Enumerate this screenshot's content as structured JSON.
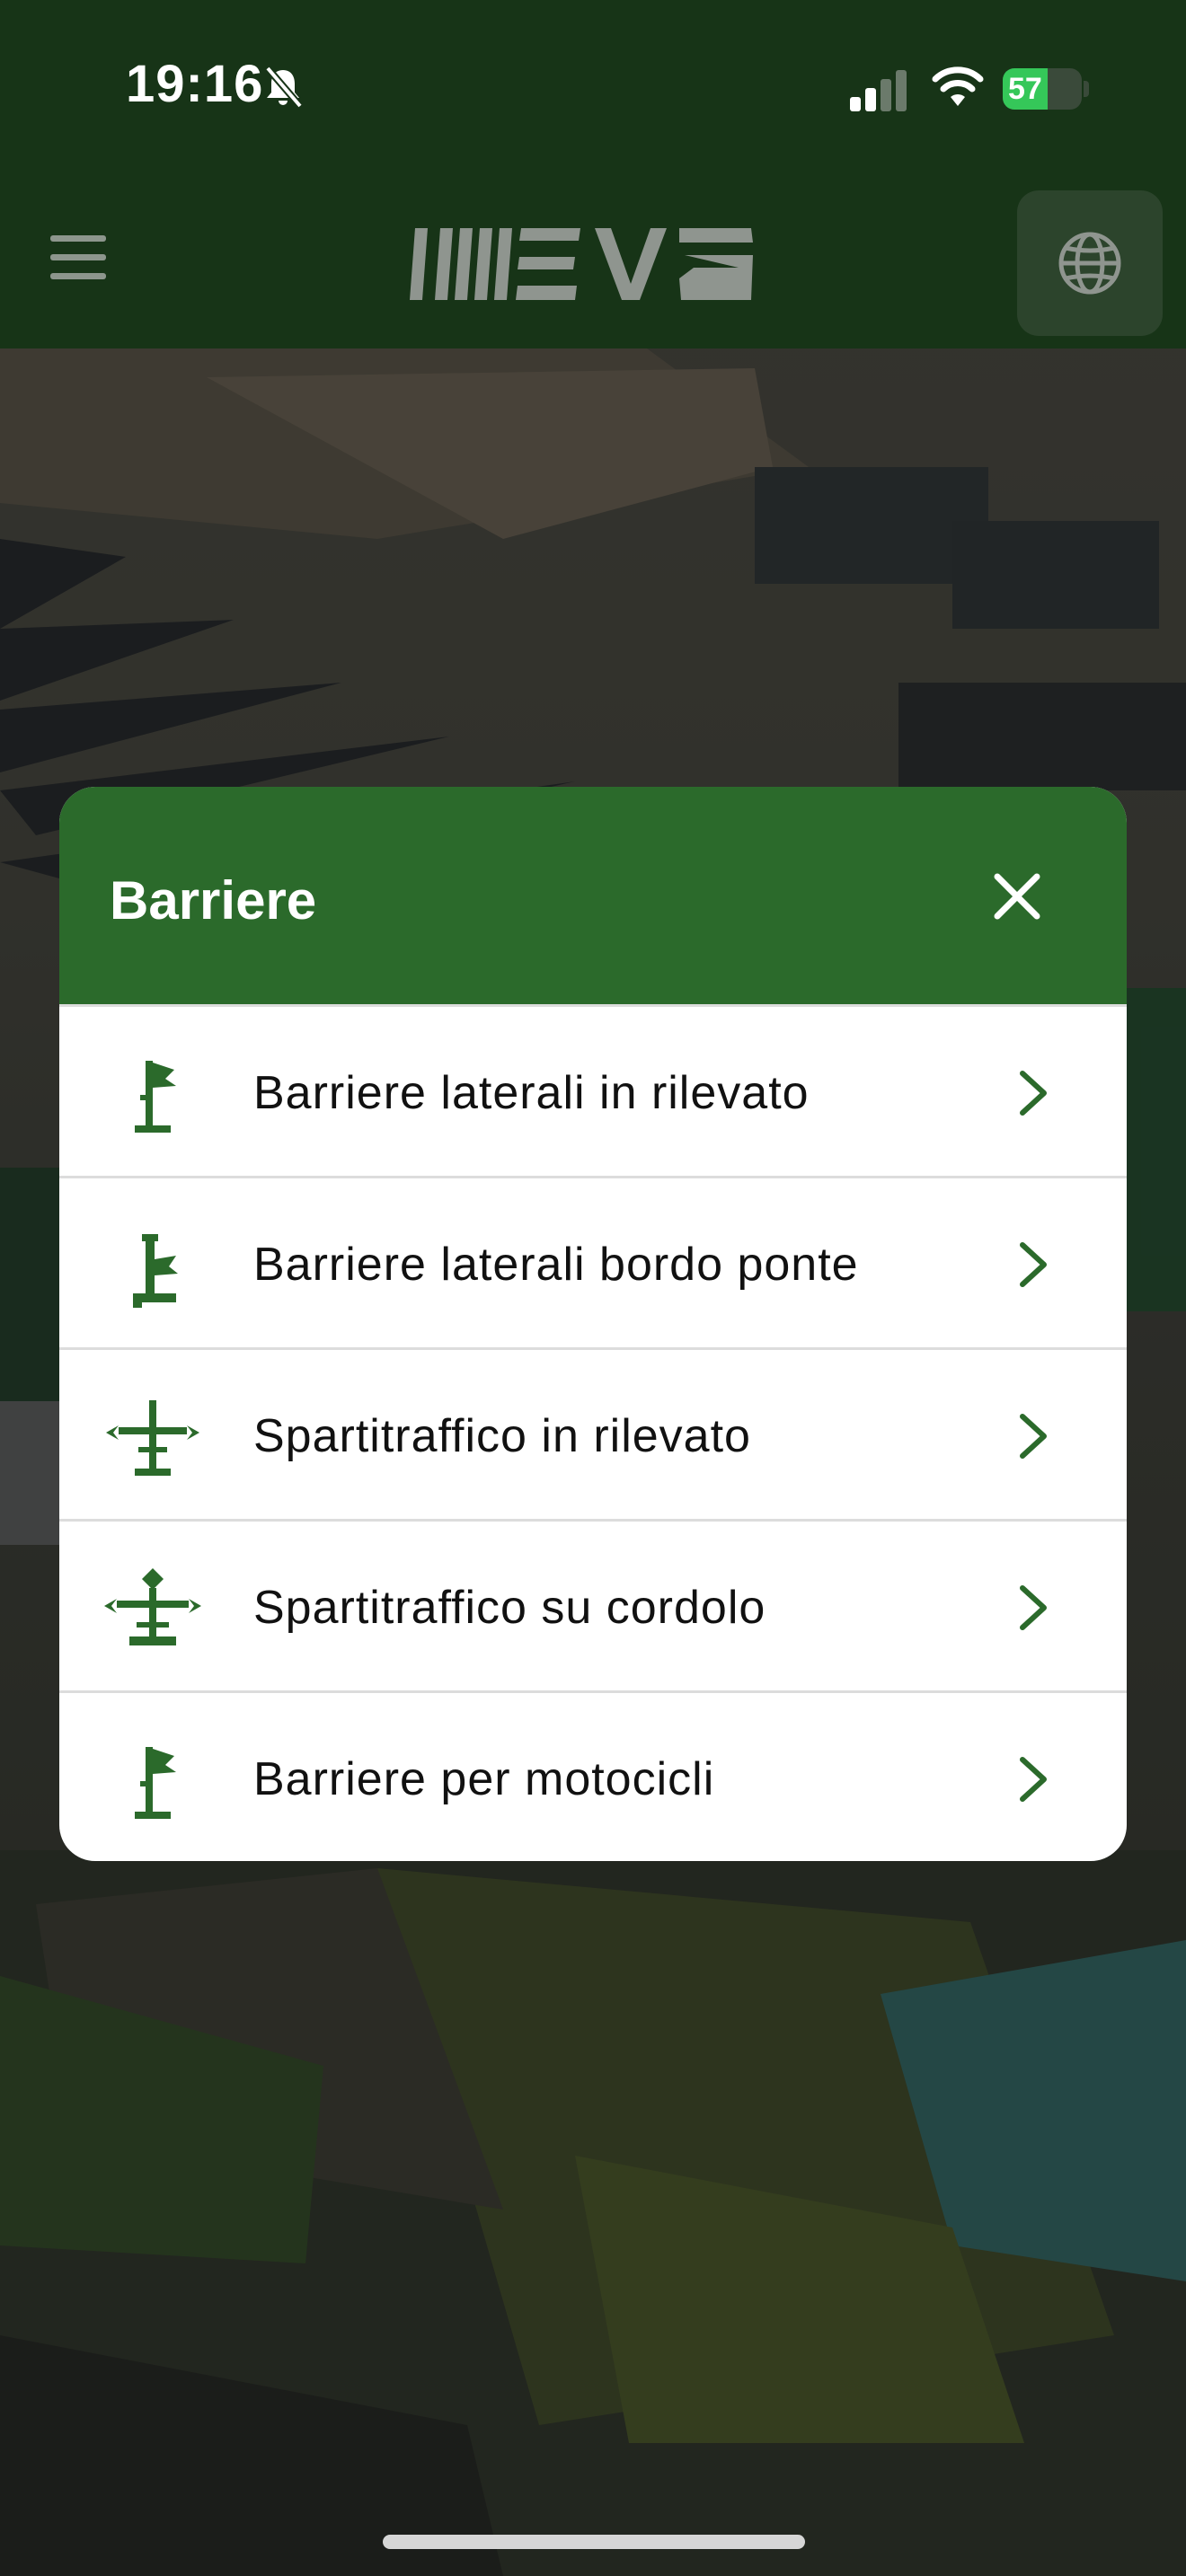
{
  "status_bar": {
    "time": "19:16",
    "battery": "57",
    "battery_level": 0.57
  },
  "header": {
    "menu_icon": "hamburger-icon",
    "logo": "IMEVA",
    "language_icon": "globe-icon"
  },
  "modal": {
    "title": "Barriere",
    "close_icon": "close-icon",
    "items": [
      {
        "label": "Barriere laterali in rilevato",
        "icon": "side-barrier-embankment-icon"
      },
      {
        "label": "Barriere laterali bordo ponte",
        "icon": "side-barrier-bridge-icon"
      },
      {
        "label": "Spartitraffico in rilevato",
        "icon": "median-embankment-icon"
      },
      {
        "label": "Spartitraffico su cordolo",
        "icon": "median-kerb-icon"
      },
      {
        "label": "Barriere per motocicli",
        "icon": "motorcycle-barrier-icon"
      }
    ]
  },
  "colors": {
    "header_bg": "#173417",
    "modal_header_bg": "#2b6a2b",
    "accent": "#2b6a2b"
  }
}
